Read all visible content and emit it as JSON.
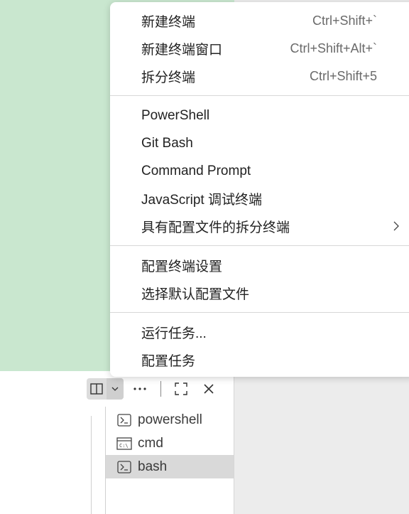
{
  "menu": {
    "groups": [
      [
        {
          "label": "新建终端",
          "shortcut": "Ctrl+Shift+`"
        },
        {
          "label": "新建终端窗口",
          "shortcut": "Ctrl+Shift+Alt+`"
        },
        {
          "label": "拆分终端",
          "shortcut": "Ctrl+Shift+5"
        }
      ],
      [
        {
          "label": "PowerShell"
        },
        {
          "label": "Git Bash"
        },
        {
          "label": "Command Prompt"
        },
        {
          "label": "JavaScript 调试终端"
        },
        {
          "label": "具有配置文件的拆分终端",
          "submenu_icon": "chevron-right-icon"
        }
      ],
      [
        {
          "label": "配置终端设置"
        },
        {
          "label": "选择默认配置文件"
        }
      ],
      [
        {
          "label": "运行任务..."
        },
        {
          "label": "配置任务"
        }
      ]
    ]
  },
  "toolbar": {
    "icons": [
      "split-terminal-icon",
      "chevron-down-icon",
      "more-icon",
      "maximize-icon",
      "close-icon"
    ]
  },
  "terminals": [
    {
      "label": "powershell",
      "icon": "terminal-icon",
      "selected": false
    },
    {
      "label": "cmd",
      "icon": "cmd-icon",
      "selected": false
    },
    {
      "label": "bash",
      "icon": "terminal-icon",
      "selected": true
    }
  ],
  "colors": {
    "editor_bg": "#c9e7cf",
    "panel_bg": "#ececec",
    "selection": "#d9d9d9"
  }
}
